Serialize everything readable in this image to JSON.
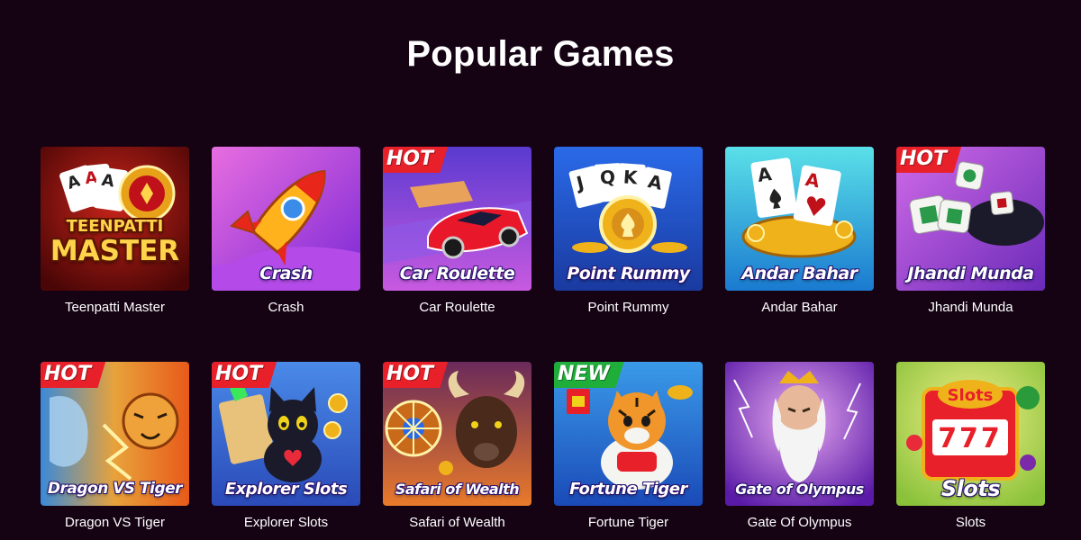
{
  "page": {
    "title": "Popular Games"
  },
  "games": [
    {
      "label": "Teenpatti Master",
      "logo_line1": "TEENPATTI",
      "logo_line2": "MASTER",
      "badge": ""
    },
    {
      "label": "Crash",
      "banner": "Crash",
      "badge": ""
    },
    {
      "label": "Car Roulette",
      "banner": "Car Roulette",
      "badge": "HOT"
    },
    {
      "label": "Point Rummy",
      "banner": "Point Rummy",
      "badge": "",
      "cards": [
        "J",
        "Q",
        "K",
        "A"
      ]
    },
    {
      "label": "Andar Bahar",
      "banner": "Andar Bahar",
      "badge": "",
      "cards": [
        "A",
        "A"
      ]
    },
    {
      "label": "Jhandi Munda",
      "banner": "Jhandi Munda",
      "badge": "HOT"
    },
    {
      "label": "Dragon VS Tiger",
      "banner": "Dragon VS Tiger",
      "badge": "HOT"
    },
    {
      "label": "Explorer Slots",
      "banner": "Explorer Slots",
      "badge": "HOT"
    },
    {
      "label": "Safari of Wealth",
      "banner": "Safari of Wealth",
      "badge": "HOT"
    },
    {
      "label": "Fortune Tiger",
      "banner": "Fortune Tiger",
      "badge": "NEW"
    },
    {
      "label": "Gate Of Olympus",
      "banner": "Gate of Olympus",
      "badge": ""
    },
    {
      "label": "Slots",
      "banner": "Slots",
      "badge": "",
      "sign": "Slots",
      "reels": "777"
    }
  ],
  "colors": {
    "background": "#150314",
    "hot_badge": "#e8202a",
    "new_badge": "#1fae3a",
    "text": "#ffffff"
  }
}
